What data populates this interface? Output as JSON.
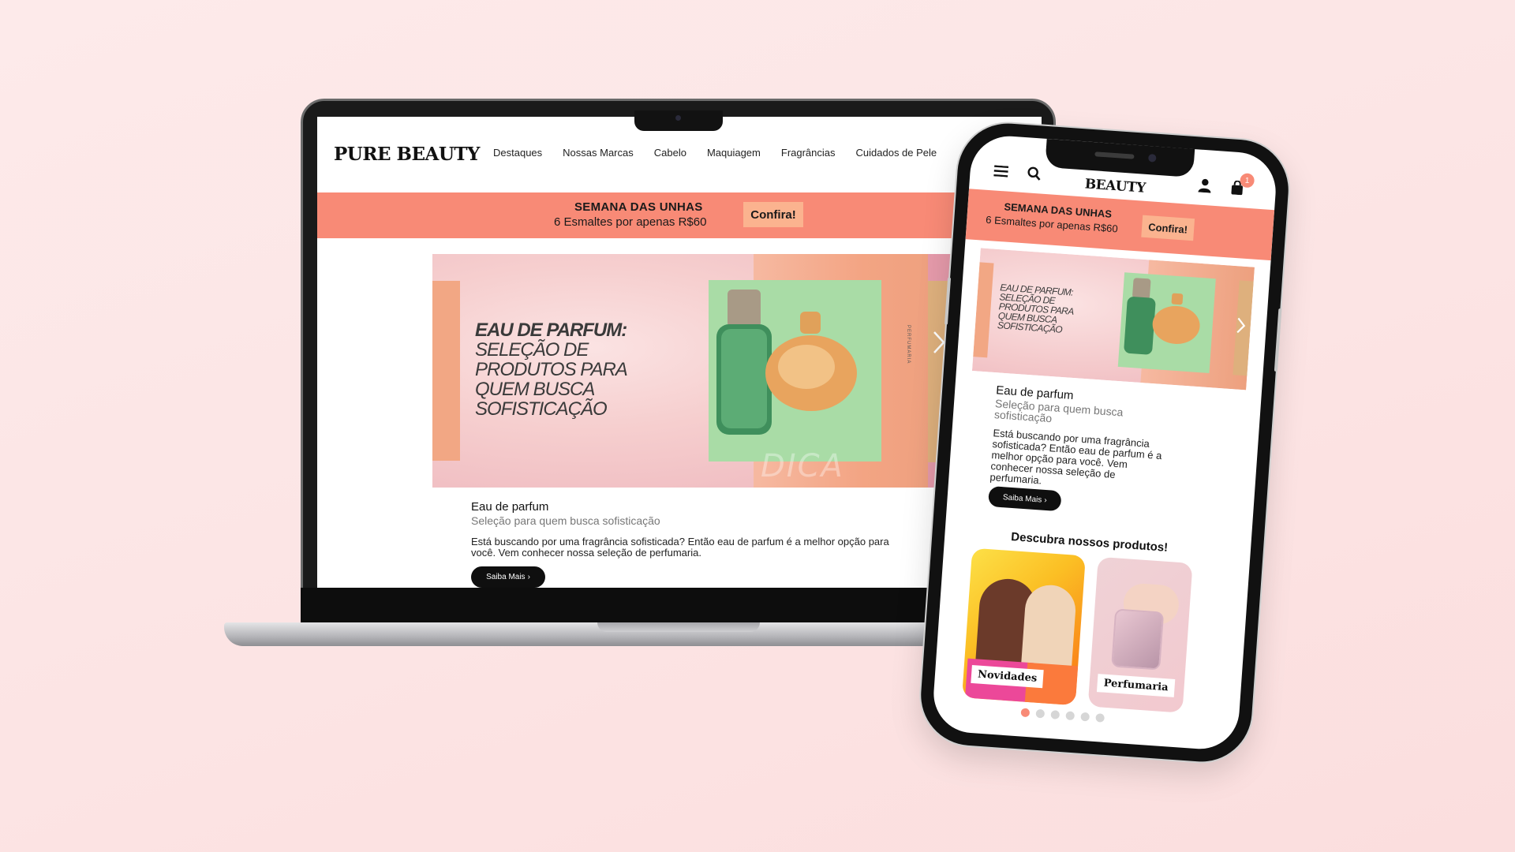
{
  "brand": "PURE BEAUTY",
  "brand_short": "BEAUTY",
  "nav": [
    "Destaques",
    "Nossas Marcas",
    "Cabelo",
    "Maquiagem",
    "Fragrâncias",
    "Cuidados de Pele"
  ],
  "promo": {
    "title": "SEMANA DAS UNHAS",
    "subtitle": "6 Esmaltes por apenas R$60",
    "cta": "Confira!"
  },
  "banner": {
    "headline_lines": [
      "EAU DE PARFUM:",
      "SELEÇÃO DE",
      "PRODUTOS PARA",
      "QUEM BUSCA",
      "SOFISTICAÇÃO"
    ],
    "vertical_label": "PERFUMARIA",
    "watermark": "DICA"
  },
  "article": {
    "title": "Eau de parfum",
    "subtitle": "Seleção para quem busca sofisticação",
    "description": "Está buscando por uma fragrância sofisticada? Então eau de parfum é a melhor opção para você. Vem conhecer nossa seleção de perfumaria.",
    "cta": "Saiba Mais"
  },
  "mobile": {
    "cart_count": "1",
    "section_title": "Descubra nossos produtos!",
    "cards": [
      {
        "label": "Novidades"
      },
      {
        "label": "Perfumaria"
      }
    ],
    "carousel_dots": 6,
    "carousel_active": 1
  },
  "colors": {
    "accent": "#f88a76",
    "cta_bg": "#fbb38f",
    "background": "#fde7e7"
  }
}
